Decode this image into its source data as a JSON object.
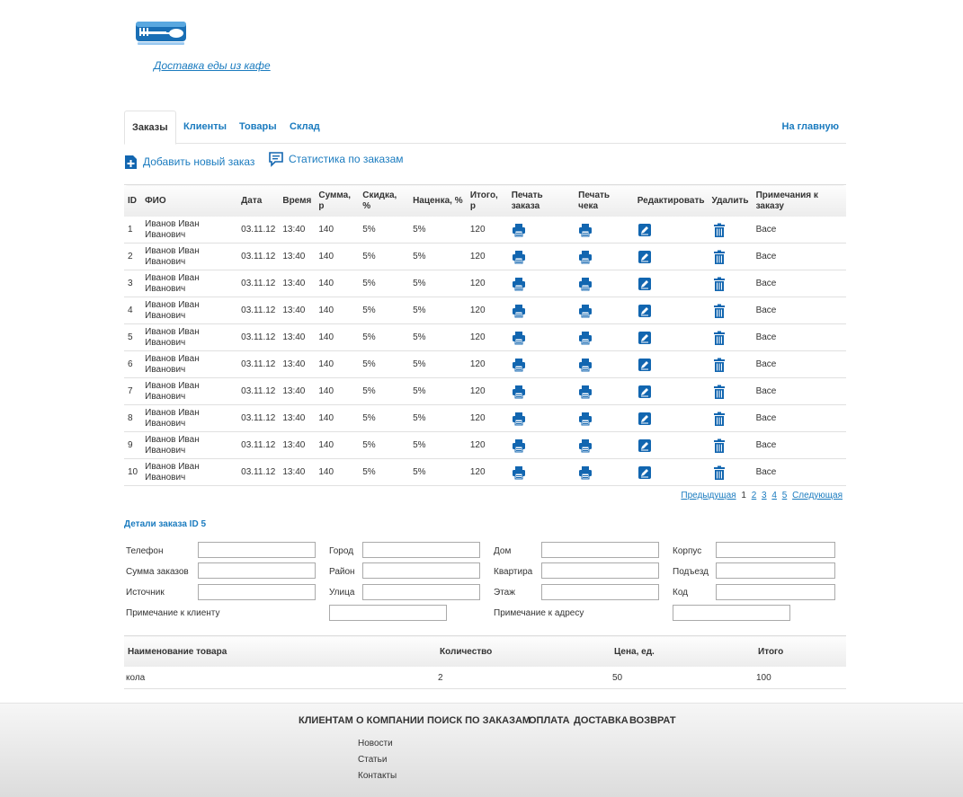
{
  "header": {
    "logo_icon": "fork-spoon-logo-icon",
    "site_link": "Доставка еды из кафе"
  },
  "tabs": [
    {
      "label": "Заказы",
      "active": true
    },
    {
      "label": "Клиенты"
    },
    {
      "label": "Товары"
    },
    {
      "label": "Склад"
    }
  ],
  "home_link": "На главную",
  "actions": {
    "add_order": "Добавить новый заказ",
    "stats": "Статистика по заказам"
  },
  "orders": {
    "columns": [
      "ID",
      "ФИО",
      "Дата",
      "Время",
      "Сумма, р",
      "Скидка, %",
      "Наценка, %",
      "Итого, р",
      "Печать заказа",
      "Печать чека",
      "Редактировать",
      "Удалить",
      "Примечания к заказу"
    ],
    "rows": [
      {
        "id": "1",
        "name": "Иванов Иван Иванович",
        "date": "03.11.12",
        "time": "13:40",
        "sum": "140",
        "discount": "5%",
        "markup": "5%",
        "total": "120",
        "note": "Васе"
      },
      {
        "id": "2",
        "name": "Иванов Иван Иванович",
        "date": "03.11.12",
        "time": "13:40",
        "sum": "140",
        "discount": "5%",
        "markup": "5%",
        "total": "120",
        "note": "Васе"
      },
      {
        "id": "3",
        "name": "Иванов Иван Иванович",
        "date": "03.11.12",
        "time": "13:40",
        "sum": "140",
        "discount": "5%",
        "markup": "5%",
        "total": "120",
        "note": "Васе"
      },
      {
        "id": "4",
        "name": "Иванов Иван Иванович",
        "date": "03.11.12",
        "time": "13:40",
        "sum": "140",
        "discount": "5%",
        "markup": "5%",
        "total": "120",
        "note": "Васе"
      },
      {
        "id": "5",
        "name": "Иванов Иван Иванович",
        "date": "03.11.12",
        "time": "13:40",
        "sum": "140",
        "discount": "5%",
        "markup": "5%",
        "total": "120",
        "note": "Васе"
      },
      {
        "id": "6",
        "name": "Иванов Иван Иванович",
        "date": "03.11.12",
        "time": "13:40",
        "sum": "140",
        "discount": "5%",
        "markup": "5%",
        "total": "120",
        "note": "Васе"
      },
      {
        "id": "7",
        "name": "Иванов Иван Иванович",
        "date": "03.11.12",
        "time": "13:40",
        "sum": "140",
        "discount": "5%",
        "markup": "5%",
        "total": "120",
        "note": "Васе"
      },
      {
        "id": "8",
        "name": "Иванов Иван Иванович",
        "date": "03.11.12",
        "time": "13:40",
        "sum": "140",
        "discount": "5%",
        "markup": "5%",
        "total": "120",
        "note": "Васе"
      },
      {
        "id": "9",
        "name": "Иванов Иван Иванович",
        "date": "03.11.12",
        "time": "13:40",
        "sum": "140",
        "discount": "5%",
        "markup": "5%",
        "total": "120",
        "note": "Васе"
      },
      {
        "id": "10",
        "name": "Иванов Иван Иванович",
        "date": "03.11.12",
        "time": "13:40",
        "sum": "140",
        "discount": "5%",
        "markup": "5%",
        "total": "120",
        "note": "Васе"
      }
    ]
  },
  "pager": {
    "prev": "Предыдущая",
    "current": "1",
    "pages": [
      "2",
      "3",
      "4",
      "5"
    ],
    "next": "Следующая"
  },
  "details": {
    "title": "Детали заказа ID 5",
    "fields": {
      "phone": "Телефон",
      "orders_sum": "Сумма заказов",
      "source": "Источник",
      "client_note": "Примечание к клиенту",
      "city": "Город",
      "district": "Район",
      "street": "Улица",
      "address_note": "Примечание к адресу",
      "house": "Дом",
      "apartment": "Квартира",
      "floor": "Этаж",
      "building": "Корпус",
      "entrance": "Подъезд",
      "code": "Код"
    }
  },
  "items": {
    "columns": [
      "Наименование товара",
      "Количество",
      "Цена, ед.",
      "Итого"
    ],
    "rows": [
      {
        "name": "кола",
        "qty": "2",
        "price": "50",
        "total": "100"
      }
    ]
  },
  "footer": {
    "nav": [
      "Клиентам",
      "О компании",
      "Поиск по заказам",
      "Оплата",
      "Доставка",
      "Возврат"
    ],
    "sub": [
      "Новости",
      "Статьи",
      "Контакты"
    ]
  },
  "colors": {
    "accent": "#1a7bbf",
    "icon_blue": "#1266b0"
  }
}
